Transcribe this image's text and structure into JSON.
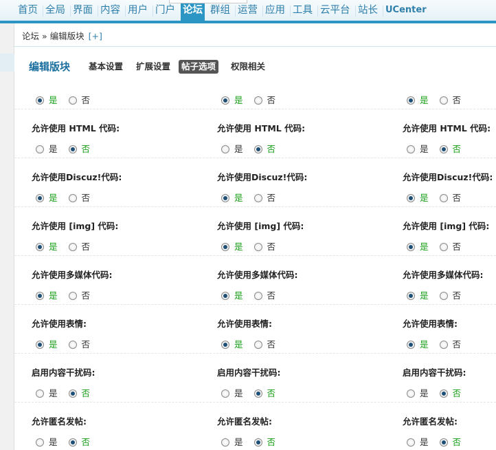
{
  "nav": {
    "items": [
      "首页",
      "全局",
      "界面",
      "内容",
      "用户",
      "门户",
      "论坛",
      "群组",
      "运营",
      "应用",
      "工具",
      "云平台",
      "站长",
      "UCenter"
    ],
    "active_index": 6
  },
  "breadcrumb": {
    "path": "论坛 » 编辑版块",
    "add_label": "[+]"
  },
  "page": {
    "title": "编辑版块",
    "tabs": [
      "基本设置",
      "扩展设置",
      "帖子选项",
      "权限相关"
    ],
    "active_tab": 2
  },
  "options": {
    "yes": "是",
    "no": "否"
  },
  "rows": [
    {
      "label": "",
      "values": [
        true,
        true,
        true
      ],
      "partial": true
    },
    {
      "label": "允许使用 HTML 代码:",
      "values": [
        false,
        false,
        false
      ]
    },
    {
      "label": "允许使用Discuz!代码:",
      "values": [
        true,
        true,
        true
      ]
    },
    {
      "label": "允许使用 [img] 代码:",
      "values": [
        true,
        true,
        true
      ]
    },
    {
      "label": "允许使用多媒体代码:",
      "values": [
        true,
        true,
        true
      ]
    },
    {
      "label": "允许使用表情:",
      "values": [
        true,
        true,
        true
      ]
    },
    {
      "label": "启用内容干扰码:",
      "values": [
        false,
        false,
        false
      ]
    },
    {
      "label": "允许匿名发帖:",
      "values": [
        false,
        false,
        false
      ]
    }
  ],
  "colors": {
    "accent": "#2b96c4",
    "link": "#2f7fab",
    "selected_text": "#1aa01a"
  }
}
